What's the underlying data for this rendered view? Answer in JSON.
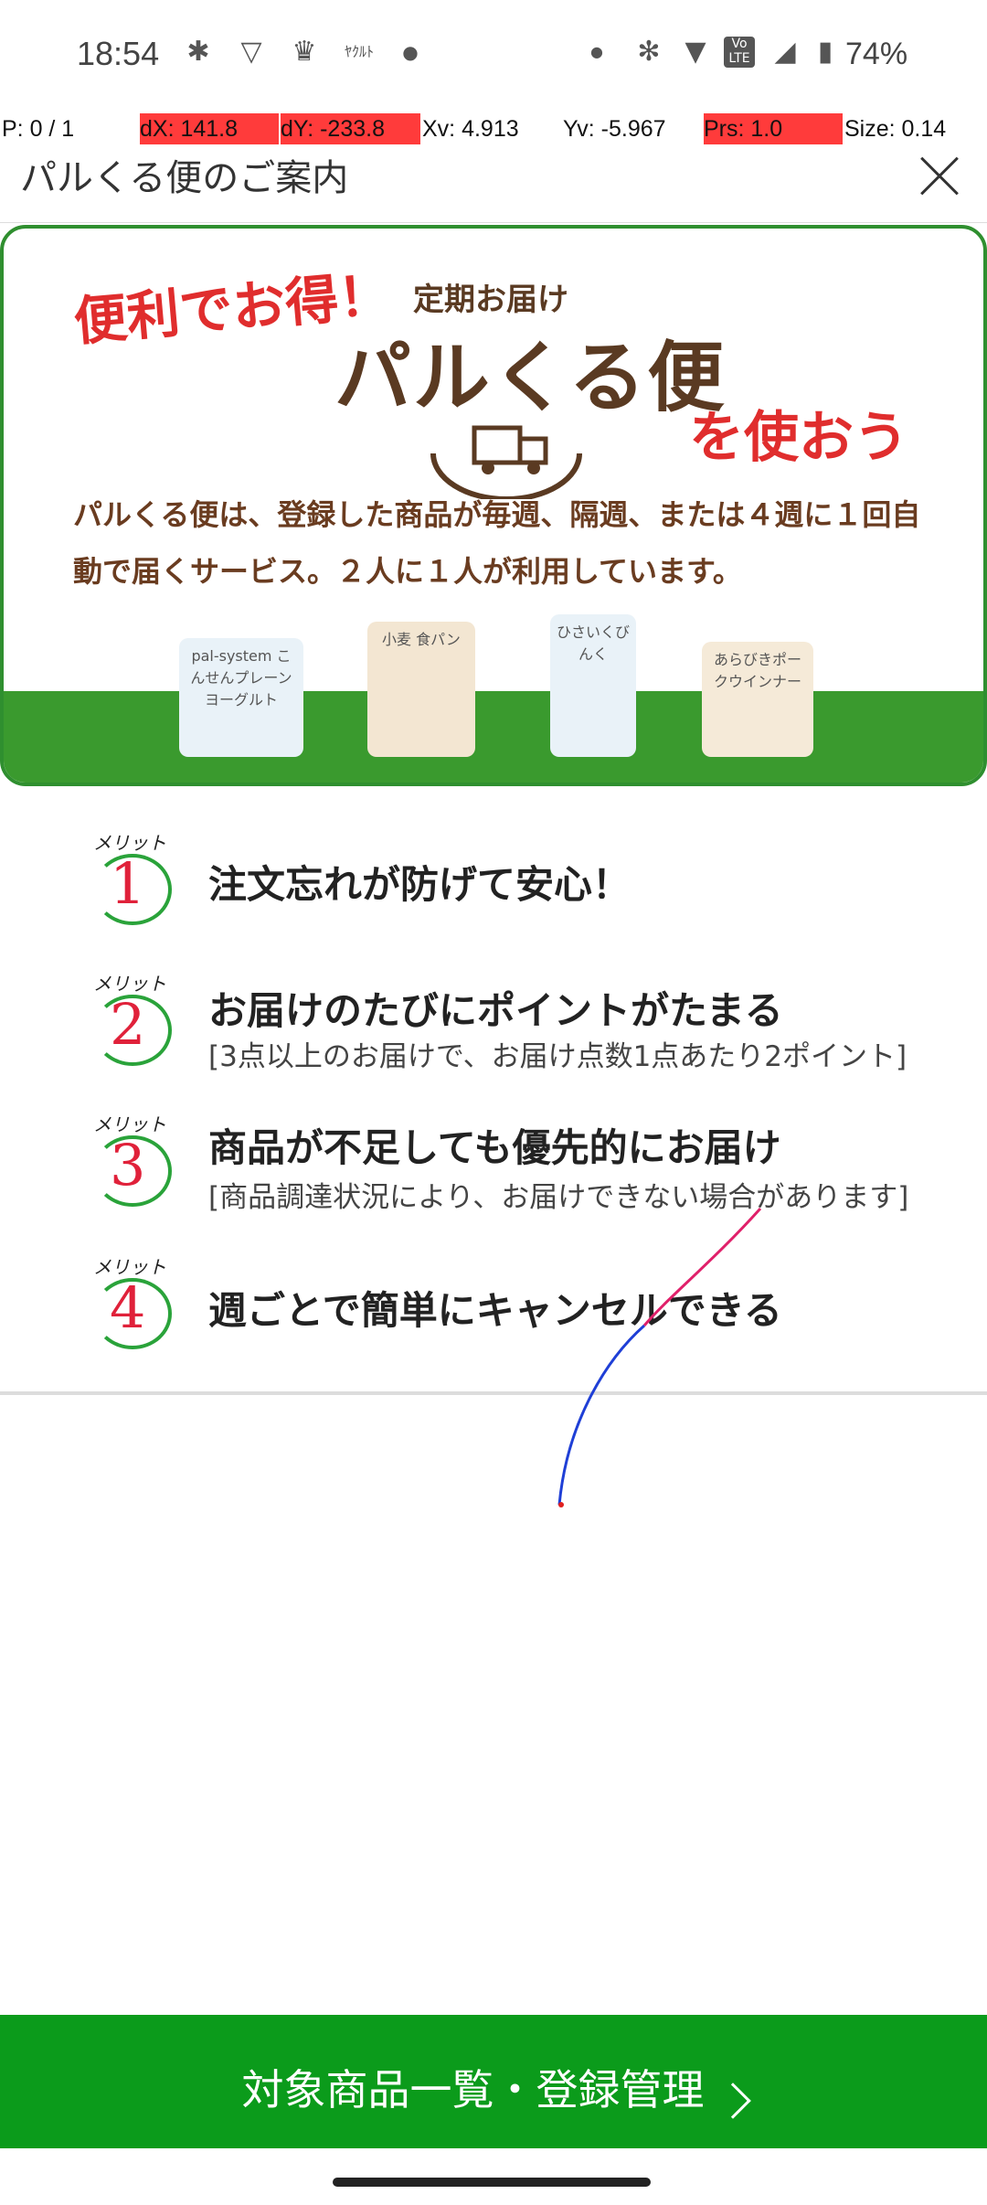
{
  "status_bar": {
    "time": "18:54",
    "icons": [
      "slack-icon",
      "vpn-icon",
      "trophy-icon",
      "app-icon",
      "dot-icon",
      "dot-icon",
      "bluetooth-icon",
      "wifi-icon",
      "volte-icon",
      "signal-icon",
      "battery-icon"
    ],
    "battery": "74%"
  },
  "debug": {
    "pointer": "P: 0 / 1",
    "dx": "dX: 141.8",
    "dy": "dY: -233.8",
    "xv": "Xv: 4.913",
    "yv": "Yv: -5.967",
    "prs": "Prs: 1.0",
    "size": "Size: 0.14"
  },
  "header": {
    "title": "パルくる便のご案内"
  },
  "banner": {
    "catch": "便利でお得！",
    "sub": "定期お届け",
    "logo": "パルくる便",
    "use": "を使おう",
    "description": "パルくる便は、登録した商品が毎週、隔週、または４週に１回自動で届くサービス。２人に１人が利用しています。",
    "products": [
      "pal-system こんせんプレーンヨーグルト",
      "小麦 食パン",
      "ひさいくびんく",
      "あらびきポークウインナー"
    ]
  },
  "merits": [
    {
      "label": "メリット",
      "number": "1",
      "title": "注文忘れが防げて安心！",
      "note": ""
    },
    {
      "label": "メリット",
      "number": "2",
      "title": "お届けのたびにポイントがたまる",
      "note": "[3点以上のお届けで、お届け点数1点あたり2ポイント]"
    },
    {
      "label": "メリット",
      "number": "3",
      "title": "商品が不足しても優先的にお届け",
      "note": "[商品調達状況により、お届けできない場合があります]"
    },
    {
      "label": "メリット",
      "number": "4",
      "title": "週ごとで簡単にキャンセルできる",
      "note": ""
    }
  ],
  "cta": {
    "label": "対象商品一覧・登録管理"
  },
  "colors": {
    "brand_green": "#0b9b1b",
    "accent_red": "#e02d2d",
    "logo_brown": "#5a3a22",
    "debug_red": "#ff3b3b"
  }
}
